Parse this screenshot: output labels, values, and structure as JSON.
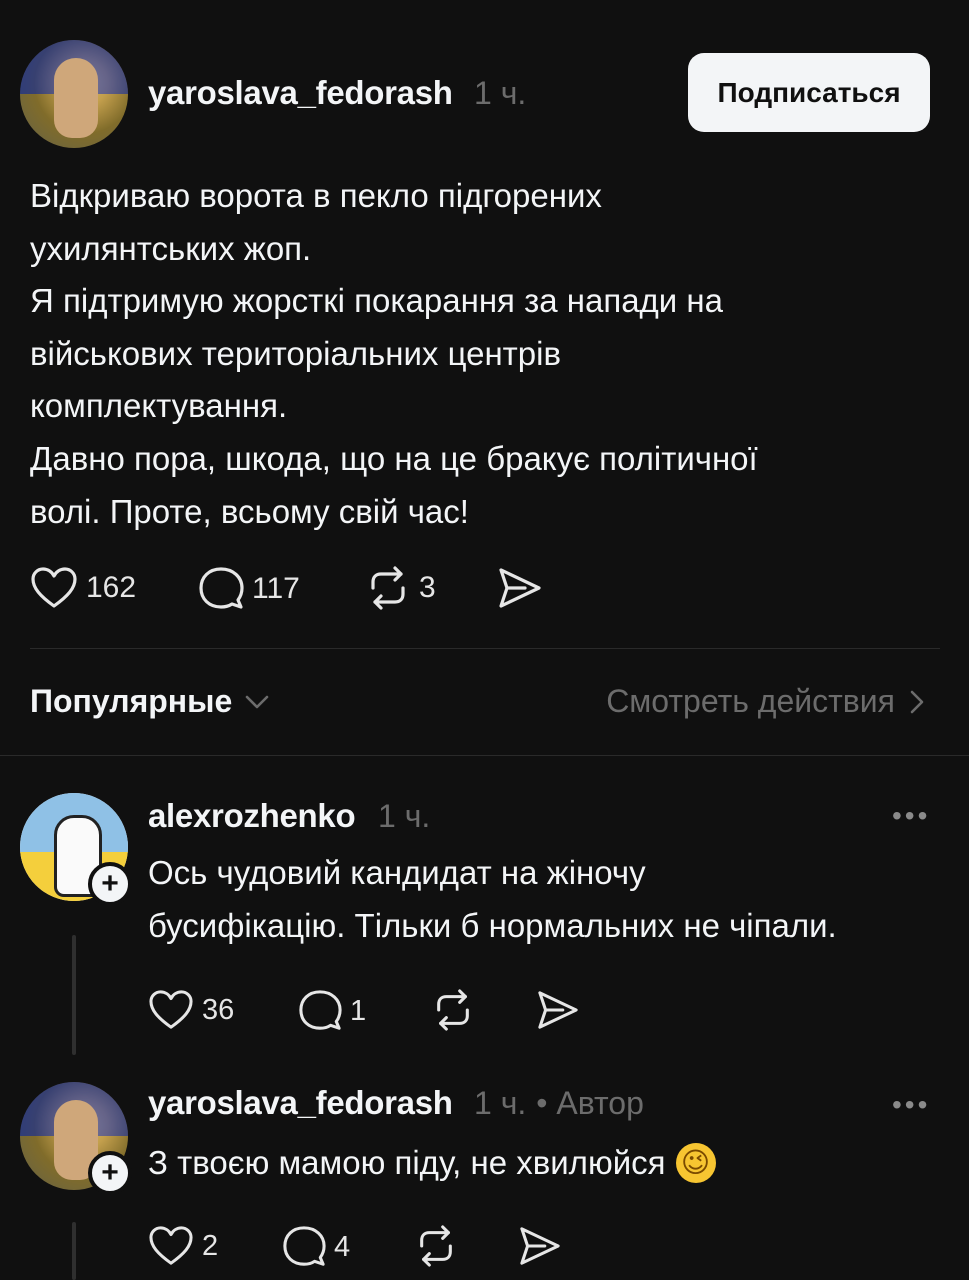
{
  "post": {
    "username": "yaroslava_fedorash",
    "time": "1 ч.",
    "follow_label": "Подписаться",
    "text": "Відкриваю ворота в пекло підгорених\nухилянтських жоп.\nЯ підтримую жорсткі покарання за напади на\nвійськових територіальних центрів\nкомплектування.\nДавно пора, шкода, що на це бракує політичної\nволі. Проте, всьому свій час!",
    "likes": "162",
    "comments": "117",
    "reposts": "3"
  },
  "sort": {
    "label": "Популярные",
    "activity_link": "Смотреть действия"
  },
  "replies": [
    {
      "username": "alexrozhenko",
      "time": "1 ч.",
      "author_tag": "",
      "text": "Ось чудовий кандидат на жіночу\nбусифікацію. Тільки б нормальних не чіпали.",
      "likes": "36",
      "comments": "1",
      "more": "•••"
    },
    {
      "username": "yaroslava_fedorash",
      "time": "1 ч.",
      "author_tag": "• Автор",
      "text": "З твоєю мамою піду, не хвилюйся",
      "emoji": "😉",
      "likes": "2",
      "comments": "4",
      "more": "•••"
    }
  ],
  "icons": {
    "heart": "heart-icon",
    "comment": "comment-icon",
    "repost": "repost-icon",
    "share": "share-icon",
    "chevron_down": "chevron-down-icon",
    "chevron_right": "chevron-right-icon",
    "plus": "+"
  },
  "colors": {
    "background": "#101010",
    "text": "#f3f5f7",
    "muted": "#6c6c6c",
    "button_bg": "#f3f5f7"
  }
}
